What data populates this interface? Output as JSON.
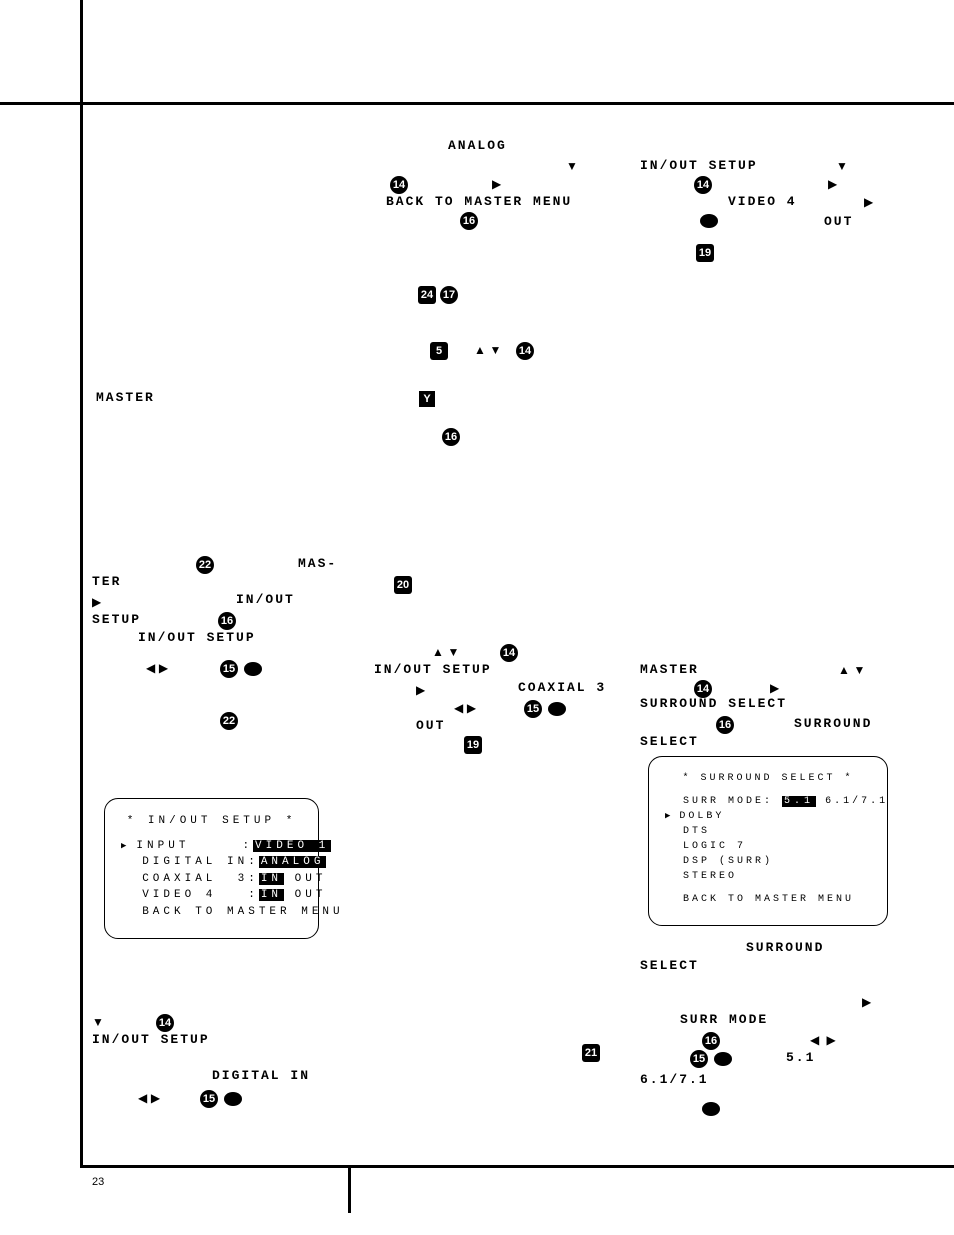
{
  "page_number": "23",
  "labels": {
    "analog": "ANALOG",
    "back_to_master": "BACK TO MASTER MENU",
    "inout_setup": "IN/OUT SETUP",
    "video4": "VIDEO 4",
    "out": "OUT",
    "master": "MASTER",
    "mas": "MAS-",
    "ter": "TER",
    "inout": "IN/OUT",
    "setup": "SETUP",
    "in_out_setup": "IN/OUT SETUP",
    "coaxial3": "COAXIAL 3",
    "surround_select": "SURROUND SELECT",
    "surround": "SURROUND",
    "select": "SELECT",
    "surr_mode": "SURR MODE",
    "digital_in": "DIGITAL IN",
    "v51": "5.1",
    "v6171": "6.1/7.1"
  },
  "badges": {
    "b5": "5",
    "b14": "14",
    "b15": "15",
    "b16": "16",
    "b17": "17",
    "b19": "19",
    "b20": "20",
    "b21": "21",
    "b22": "22",
    "b24": "24",
    "Y": "Y"
  },
  "osd1": {
    "title": "* IN/OUT SETUP *",
    "input_label": "INPUT",
    "input_value": "VIDEO 1",
    "digin_label": "DIGITAL IN",
    "digin_value": "ANALOG",
    "coax_label": "COAXIAL  3",
    "in": "IN",
    "out": "OUT",
    "vid4_label": "VIDEO 4",
    "back": "BACK TO MASTER MENU"
  },
  "osd2": {
    "title": "* SURROUND SELECT *",
    "mode_label": "SURR MODE",
    "mode_v1": "5.1",
    "mode_v2": "6.1/7.1",
    "dolby": "DOLBY",
    "dts": "DTS",
    "logic7": "LOGIC 7",
    "dsp": "DSP (SURR)",
    "stereo": "STEREO",
    "back": "BACK TO MASTER MENU"
  }
}
